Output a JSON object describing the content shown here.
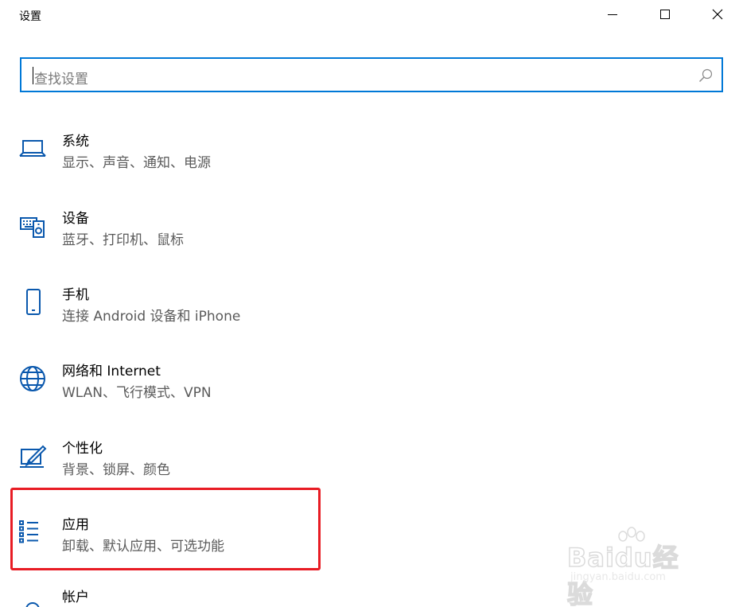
{
  "window": {
    "title": "设置",
    "minimize_icon": "minimize-icon",
    "maximize_icon": "maximize-icon",
    "close_icon": "close-icon"
  },
  "search": {
    "placeholder": "查找设置",
    "icon": "search-icon"
  },
  "accent_color": "#0078d7",
  "highlight_color": "#e81c24",
  "categories": [
    {
      "label": "系统",
      "description": "显示、声音、通知、电源",
      "icon": "laptop-icon"
    },
    {
      "label": "设备",
      "description": "蓝牙、打印机、鼠标",
      "icon": "devices-icon"
    },
    {
      "label": "手机",
      "description": "连接 Android 设备和 iPhone",
      "icon": "phone-icon"
    },
    {
      "label": "网络和 Internet",
      "description": "WLAN、飞行模式、VPN",
      "icon": "globe-icon"
    },
    {
      "label": "个性化",
      "description": "背景、锁屏、颜色",
      "icon": "paint-icon"
    },
    {
      "label": "应用",
      "description": "卸载、默认应用、可选功能",
      "icon": "apps-list-icon"
    },
    {
      "label": "帐户",
      "description": "",
      "icon": "account-icon"
    }
  ],
  "watermark": {
    "brand": "Baidu经验",
    "url": "jingyan.baidu.com"
  }
}
